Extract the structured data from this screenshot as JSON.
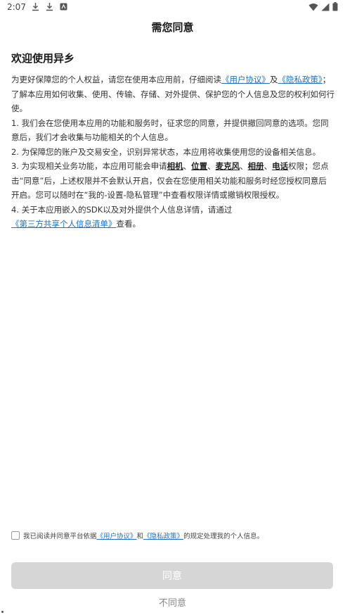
{
  "status_bar": {
    "time": "2:07",
    "icons_left": [
      "download-icon",
      "download-icon",
      "notification-icon"
    ],
    "icons_right": [
      "wifi-icon",
      "signal-icon",
      "battery-icon"
    ]
  },
  "header": {
    "title": "需您同意"
  },
  "content": {
    "welcome": "欢迎使用异乡",
    "intro": {
      "pre": "为更好保障您的个人权益，请您在使用本应用前，仔细阅读",
      "link1": "《用户协议》",
      "mid": "及",
      "link2": "《隐私政策》",
      "post": "；了解本应用如何收集、使用、传输、存储、对外提供、保护您的个人信息及您的权利如何行使。"
    },
    "item1": "1. 我们会在您使用本应用的功能和服务时，征求您的同意，并提供撤回同意的选项。您同意后，我们才会收集与功能相关的个人信息。",
    "item2": "2. 为保障您的账户及交易安全，识别异常状态，本应用将收集使用您的设备相关信息。",
    "item3": {
      "pre": "3. 为实现相关业务功能，本应用可能会申请",
      "perm1": "相机",
      "sep1": "、",
      "perm2": "位置",
      "sep2": "、",
      "perm3": "麦克风",
      "sep3": "、",
      "perm4": "相册",
      "sep4": "、",
      "perm5": "电话",
      "post": "权限；您点击“同意”后，上述权限并不会默认开启，仅会在您使用相关功能和服务时经您授权同意后开启。您可以随时在“我的-设置-隐私管理”中查看权限详情或撤销权限授权。"
    },
    "item4": {
      "pre": "4. 关于本应用嵌入的SDK以及对外提供个人信息详情，请通过",
      "link": "《第三方共享个人信息清单》",
      "post": "查看。"
    }
  },
  "agreement": {
    "pre": "我已阅读并同意平台依据",
    "link1": "《用户协议》",
    "mid": "和",
    "link2": "《隐私政策》",
    "post": "的规定处理我的个人信息。",
    "checked": false
  },
  "buttons": {
    "agree": "同意",
    "disagree": "不同意"
  },
  "colors": {
    "link": "#1a73c8",
    "disabled_button": "#d6d6d6"
  }
}
